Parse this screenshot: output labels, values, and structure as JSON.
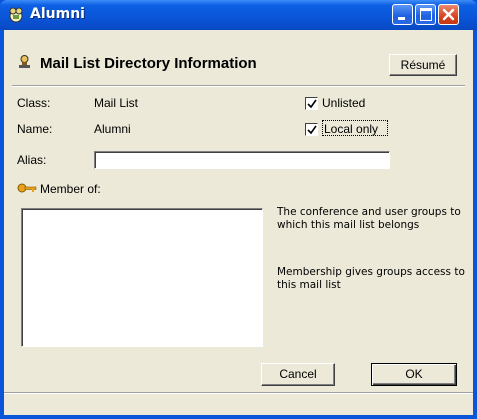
{
  "window": {
    "title": "Alumni"
  },
  "header": {
    "title": "Mail List Directory Information",
    "resume_label": "Résumé"
  },
  "fields": {
    "class_label": "Class:",
    "class_value": "Mail List",
    "name_label": "Name:",
    "name_value": "Alumni",
    "alias_label": "Alias:",
    "alias_value": ""
  },
  "checkboxes": {
    "unlisted": {
      "label": "Unlisted",
      "checked": true
    },
    "local_only": {
      "label": "Local only",
      "checked": true
    }
  },
  "member_of": {
    "label": "Member of:",
    "items": [],
    "help_1": "The conference and user groups to which this mail list belongs",
    "help_2": "Membership gives groups access to this mail list"
  },
  "buttons": {
    "cancel": "Cancel",
    "ok": "OK"
  },
  "icons": {
    "app": "mail-list-app-icon",
    "header": "directory-info-icon",
    "member": "key-icon",
    "minimize": "minimize-icon",
    "maximize": "maximize-icon",
    "close": "close-icon"
  },
  "colors": {
    "titlebar": "#0a55d8",
    "close_button": "#d9441f",
    "dialog_bg": "#ece9d8"
  }
}
